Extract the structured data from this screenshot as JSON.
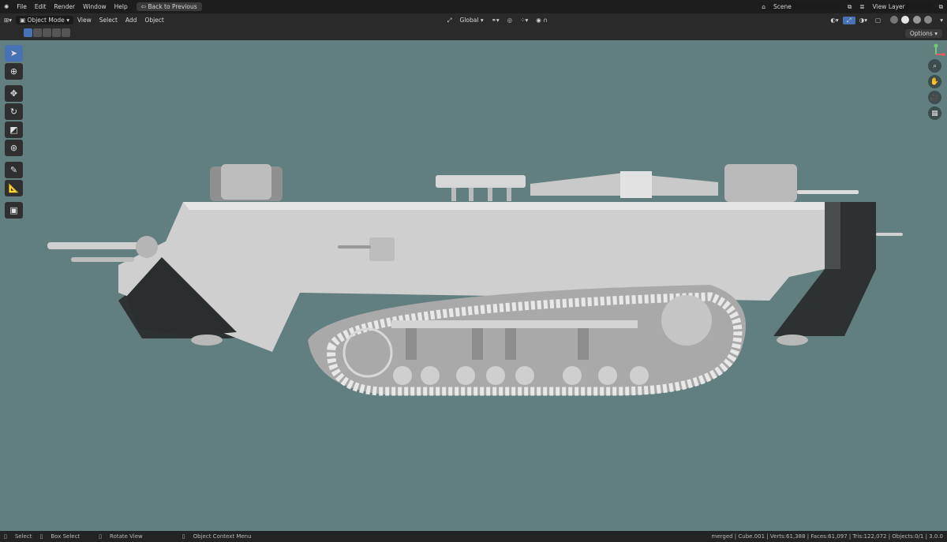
{
  "topbar": {
    "menus": [
      "File",
      "Edit",
      "Render",
      "Window",
      "Help"
    ],
    "back_label": "Back to Previous",
    "scene_label": "Scene",
    "view_layer_label": "View Layer"
  },
  "header": {
    "mode": "Object Mode",
    "menus": [
      "View",
      "Select",
      "Add",
      "Object"
    ],
    "transform_orientation": "Global",
    "options_label": "Options"
  },
  "tools": [
    "select-box",
    "cursor",
    "move",
    "rotate",
    "scale",
    "transform",
    "annotate",
    "measure",
    "add-cube"
  ],
  "statusbar": {
    "select": "Select",
    "box_select": "Box Select",
    "rotate_view": "Rotate View",
    "context_menu": "Object Context Menu",
    "stats": "merged | Cube.001 | Verts:61,388 | Faces:61,097 | Tris:122,072 | Objects:0/1 | 3.0.0"
  },
  "colors": {
    "viewport_bg": "#627f7f",
    "accent": "#4772b3",
    "model_light": "#d2d2d2",
    "model_dark": "#2e3131"
  }
}
